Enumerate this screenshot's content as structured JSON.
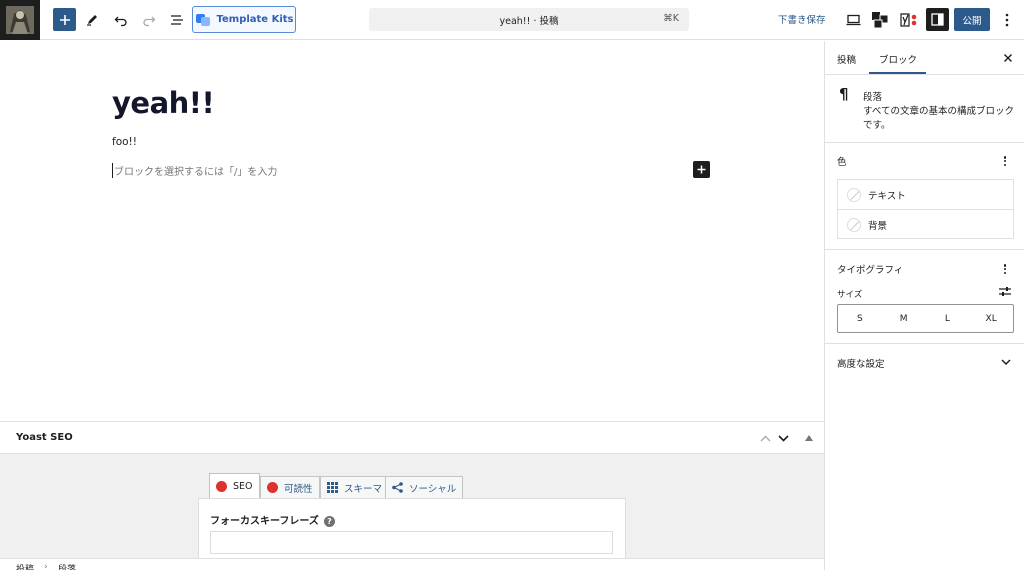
{
  "toolbar": {
    "template_kits_label": "Template Kits",
    "command_title": "yeah!! · 投稿",
    "command_shortcut": "⌘K",
    "save_draft_label": "下書き保存",
    "publish_label": "公開"
  },
  "editor": {
    "post_title": "yeah!!",
    "paragraph": "foo!!",
    "placeholder": "ブロックを選択するには「/」を入力"
  },
  "yoast": {
    "title": "Yoast SEO",
    "tabs": [
      {
        "label": "SEO",
        "icon": "sad-face-icon"
      },
      {
        "label": "可読性",
        "icon": "sad-face-icon"
      },
      {
        "label": "スキーマ",
        "icon": "grid-icon"
      },
      {
        "label": "ソーシャル",
        "icon": "share-icon"
      }
    ],
    "focus_keyphrase_label": "フォーカスキーフレーズ",
    "focus_keyphrase_value": ""
  },
  "breadcrumb": {
    "items": [
      "投稿",
      "段落"
    ],
    "separator": "›"
  },
  "sidebar": {
    "tabs": [
      {
        "label": "投稿"
      },
      {
        "label": "ブロック"
      }
    ],
    "active_tab": "ブロック",
    "block": {
      "name": "段落",
      "description": "すべての文章の基本の構成ブロックです。"
    },
    "color_panel": {
      "title": "色",
      "items": [
        "テキスト",
        "背景"
      ]
    },
    "typography_panel": {
      "title": "タイポグラフィ",
      "size_label": "サイズ",
      "sizes": [
        "S",
        "M",
        "L",
        "XL"
      ]
    },
    "advanced_label": "高度な設定"
  },
  "colors": {
    "accent": "#2c5a8a",
    "yoast_red": "#dc3232",
    "dark": "#1e1e1e"
  }
}
